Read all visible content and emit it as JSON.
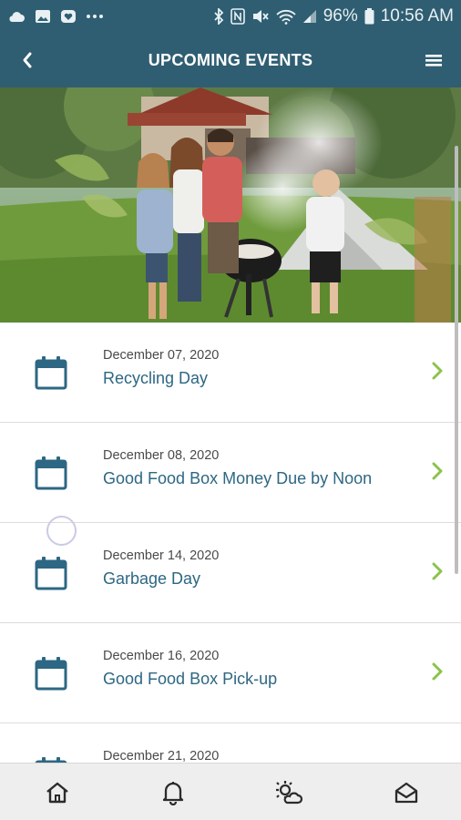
{
  "status_bar": {
    "battery": "96%",
    "time": "10:56 AM",
    "icons_left": [
      "cloud-icon",
      "gallery-icon",
      "heart-icon",
      "more-icon"
    ],
    "icons_right": [
      "bluetooth-icon",
      "nfc-icon",
      "mute-icon",
      "wifi-icon",
      "signal-icon",
      "battery-icon"
    ]
  },
  "header": {
    "title": "UPCOMING EVENTS",
    "back_icon": "chevron-left-icon",
    "menu_icon": "hamburger-menu-icon"
  },
  "hero": {
    "description_icon": "hero-photo"
  },
  "events": [
    {
      "date": "December 07, 2020",
      "name": "Recycling Day"
    },
    {
      "date": "December 08, 2020",
      "name": "Good Food Box Money Due by Noon"
    },
    {
      "date": "December 14, 2020",
      "name": "Garbage Day"
    },
    {
      "date": "December 16, 2020",
      "name": "Good Food Box Pick-up"
    },
    {
      "date": "December 21, 2020",
      "name": ""
    }
  ],
  "bottom_nav": [
    {
      "icon": "home-icon"
    },
    {
      "icon": "bell-icon"
    },
    {
      "icon": "weather-icon"
    },
    {
      "icon": "mail-open-icon"
    }
  ],
  "colors": {
    "header_bg": "#2f5e72",
    "accent_text": "#2d6783",
    "chevron": "#8bc34a",
    "nav_bg": "#eeeeee"
  }
}
